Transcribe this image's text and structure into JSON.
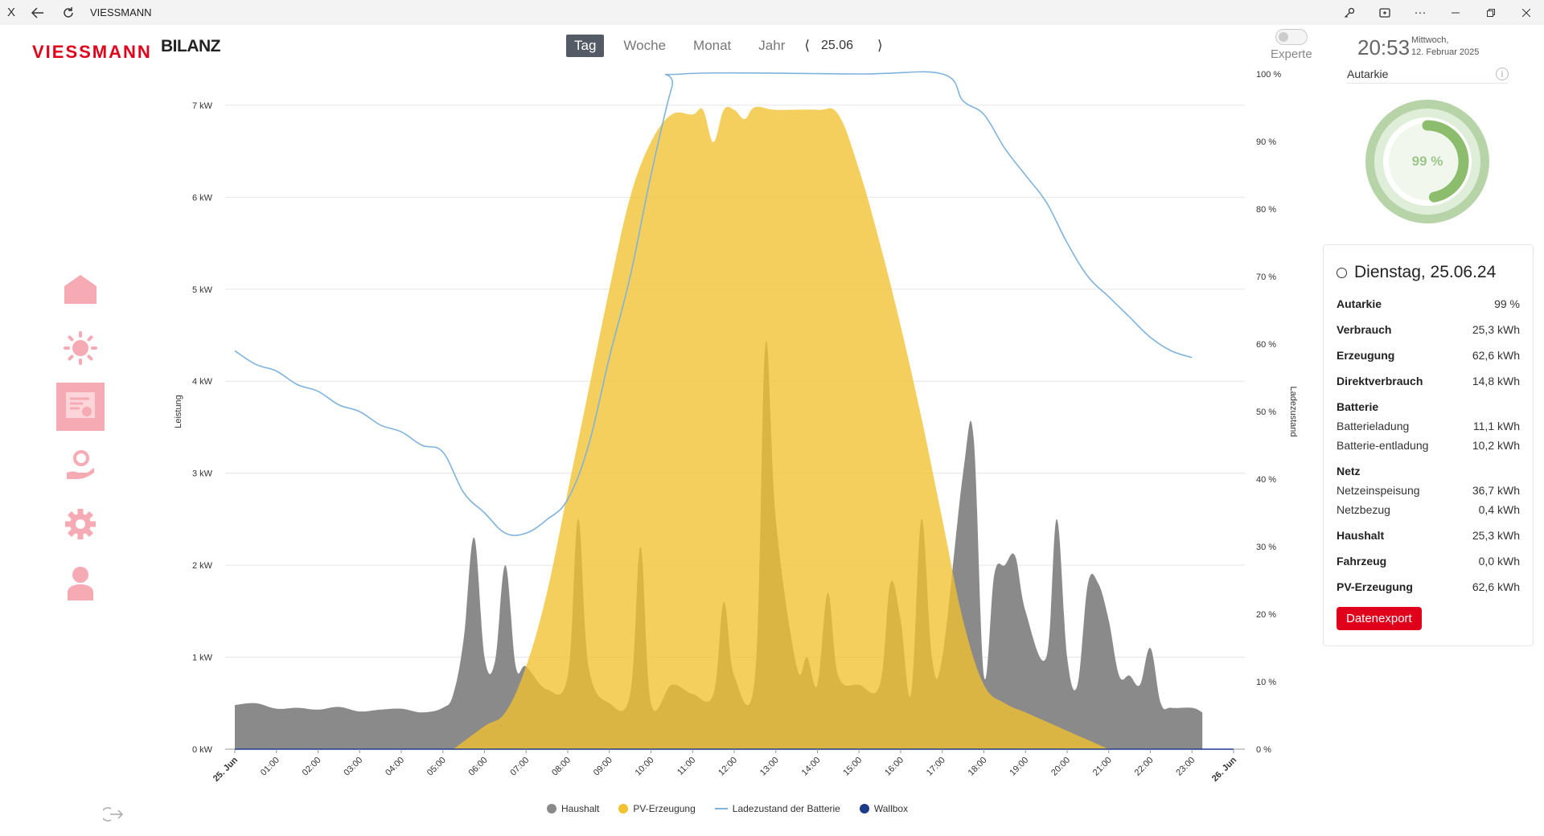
{
  "titlebar": {
    "app_name": "VIESSMANN"
  },
  "header": {
    "logo": "VIESSMANN",
    "title": "BILANZ",
    "tabs": [
      "Tag",
      "Woche",
      "Monat",
      "Jahr"
    ],
    "active_tab": "Tag",
    "date": "25.06",
    "prev_arrow": "⟨",
    "next_arrow": "⟩",
    "expert_label": "Experte"
  },
  "clock": {
    "time": "20:53",
    "weekday": "Mittwoch,",
    "date": "12. Februar 2025"
  },
  "autarkie": {
    "label": "Autarkie",
    "value": "99 %",
    "fraction": 0.99
  },
  "sidebar": {
    "items": [
      {
        "name": "home",
        "icon": "house-icon"
      },
      {
        "name": "pv",
        "icon": "sun-icon"
      },
      {
        "name": "bilanz",
        "icon": "report-icon",
        "active": true
      },
      {
        "name": "energy",
        "icon": "hand-icon"
      },
      {
        "name": "settings",
        "icon": "gear-icon"
      },
      {
        "name": "profile",
        "icon": "user-icon"
      }
    ],
    "accent": "#f6aab4"
  },
  "chart_data": {
    "type": "area",
    "ylabel_left": "Leistung",
    "ylabel_right": "Ladezustand",
    "ylim_left": [
      0,
      7.34
    ],
    "ylim_right": [
      0,
      100
    ],
    "yticks_left": [
      "0 kW",
      "1 kW",
      "2 kW",
      "3 kW",
      "4 kW",
      "5 kW",
      "6 kW",
      "7 kW"
    ],
    "yticks_right": [
      "0 %",
      "10 %",
      "20 %",
      "30 %",
      "40 %",
      "50 %",
      "60 %",
      "70 %",
      "80 %",
      "90 %",
      "100 %"
    ],
    "xticks": [
      "25. Jun",
      "01:00",
      "02:00",
      "03:00",
      "04:00",
      "05:00",
      "06:00",
      "07:00",
      "08:00",
      "09:00",
      "10:00",
      "11:00",
      "12:00",
      "13:00",
      "14:00",
      "15:00",
      "16:00",
      "17:00",
      "18:00",
      "19:00",
      "20:00",
      "21:00",
      "22:00",
      "23:00",
      "26. Jun"
    ],
    "x_unit": "hours",
    "series": [
      {
        "name": "Haushalt",
        "color": "#8a8a8a",
        "unit": "kW",
        "points": [
          [
            0,
            0.48
          ],
          [
            0.5,
            0.5
          ],
          [
            1,
            0.44
          ],
          [
            1.5,
            0.45
          ],
          [
            2,
            0.43
          ],
          [
            2.5,
            0.46
          ],
          [
            3,
            0.41
          ],
          [
            3.5,
            0.43
          ],
          [
            4,
            0.44
          ],
          [
            4.5,
            0.4
          ],
          [
            5,
            0.45
          ],
          [
            5.25,
            0.6
          ],
          [
            5.5,
            1.2
          ],
          [
            5.75,
            2.3
          ],
          [
            6,
            1.0
          ],
          [
            6.25,
            0.95
          ],
          [
            6.5,
            2.0
          ],
          [
            6.75,
            0.9
          ],
          [
            7,
            0.9
          ],
          [
            7.5,
            0.65
          ],
          [
            8,
            0.8
          ],
          [
            8.25,
            2.5
          ],
          [
            8.5,
            0.9
          ],
          [
            9,
            0.5
          ],
          [
            9.5,
            0.6
          ],
          [
            9.75,
            2.2
          ],
          [
            10,
            0.5
          ],
          [
            10.5,
            0.7
          ],
          [
            11,
            0.6
          ],
          [
            11.5,
            0.6
          ],
          [
            11.75,
            1.6
          ],
          [
            12,
            0.8
          ],
          [
            12.5,
            0.8
          ],
          [
            12.75,
            4.4
          ],
          [
            13,
            2.5
          ],
          [
            13.5,
            0.9
          ],
          [
            13.75,
            1.0
          ],
          [
            14,
            0.7
          ],
          [
            14.25,
            1.7
          ],
          [
            14.5,
            0.8
          ],
          [
            15,
            0.7
          ],
          [
            15.5,
            0.7
          ],
          [
            15.75,
            1.8
          ],
          [
            16,
            1.4
          ],
          [
            16.25,
            0.6
          ],
          [
            16.5,
            2.5
          ],
          [
            16.75,
            1.0
          ],
          [
            17,
            1.0
          ],
          [
            17.5,
            3.0
          ],
          [
            17.75,
            3.4
          ],
          [
            18,
            0.8
          ],
          [
            18.25,
            1.9
          ],
          [
            18.5,
            2.0
          ],
          [
            18.75,
            2.1
          ],
          [
            19,
            1.5
          ],
          [
            19.5,
            1.0
          ],
          [
            19.75,
            2.5
          ],
          [
            20,
            1.0
          ],
          [
            20.25,
            0.7
          ],
          [
            20.5,
            1.8
          ],
          [
            20.75,
            1.8
          ],
          [
            21,
            1.4
          ],
          [
            21.25,
            0.8
          ],
          [
            21.5,
            0.8
          ],
          [
            21.75,
            0.7
          ],
          [
            22,
            1.1
          ],
          [
            22.25,
            0.5
          ],
          [
            22.5,
            0.45
          ],
          [
            23,
            0.45
          ],
          [
            23.25,
            0.4
          ]
        ]
      },
      {
        "name": "PV-Erzeugung",
        "color": "#f2c230",
        "unit": "kW",
        "points": [
          [
            5.25,
            0
          ],
          [
            6,
            0.25
          ],
          [
            6.5,
            0.4
          ],
          [
            7,
            0.9
          ],
          [
            7.5,
            1.7
          ],
          [
            8,
            2.8
          ],
          [
            8.5,
            3.9
          ],
          [
            9,
            5.0
          ],
          [
            9.5,
            6.0
          ],
          [
            10,
            6.6
          ],
          [
            10.5,
            6.9
          ],
          [
            11,
            6.9
          ],
          [
            11.25,
            6.95
          ],
          [
            11.5,
            6.6
          ],
          [
            11.75,
            6.95
          ],
          [
            12,
            6.95
          ],
          [
            12.25,
            6.85
          ],
          [
            12.5,
            6.98
          ],
          [
            13,
            6.95
          ],
          [
            14,
            6.95
          ],
          [
            14.5,
            6.9
          ],
          [
            15,
            6.3
          ],
          [
            15.5,
            5.5
          ],
          [
            16,
            4.6
          ],
          [
            16.5,
            3.6
          ],
          [
            17,
            2.5
          ],
          [
            17.5,
            1.4
          ],
          [
            18,
            0.7
          ],
          [
            18.5,
            0.5
          ],
          [
            19,
            0.4
          ],
          [
            19.5,
            0.3
          ],
          [
            20,
            0.2
          ],
          [
            20.5,
            0.1
          ],
          [
            21,
            0.0
          ]
        ]
      },
      {
        "name": "Ladezustand der Batterie",
        "color": "#7fb3dc",
        "unit": "%",
        "points": [
          [
            0,
            59
          ],
          [
            0.5,
            57
          ],
          [
            1,
            56
          ],
          [
            1.5,
            54
          ],
          [
            2,
            53
          ],
          [
            2.5,
            51
          ],
          [
            3,
            50
          ],
          [
            3.5,
            48
          ],
          [
            4,
            47
          ],
          [
            4.5,
            45
          ],
          [
            5,
            44
          ],
          [
            5.5,
            38
          ],
          [
            6,
            35
          ],
          [
            6.5,
            32
          ],
          [
            7,
            32
          ],
          [
            7.5,
            34
          ],
          [
            8,
            37
          ],
          [
            8.5,
            45
          ],
          [
            9,
            58
          ],
          [
            9.5,
            70
          ],
          [
            10,
            85
          ],
          [
            10.5,
            98
          ],
          [
            10.75,
            100
          ],
          [
            15,
            100
          ],
          [
            17,
            100
          ],
          [
            17.5,
            96
          ],
          [
            18,
            94
          ],
          [
            18.5,
            89
          ],
          [
            19,
            85
          ],
          [
            19.5,
            81
          ],
          [
            20,
            75
          ],
          [
            20.5,
            70
          ],
          [
            21,
            67
          ],
          [
            21.5,
            64
          ],
          [
            22,
            61
          ],
          [
            22.5,
            59
          ],
          [
            23,
            58
          ]
        ]
      },
      {
        "name": "Wallbox",
        "color": "#1e3a8a",
        "unit": "kW",
        "points": [
          [
            0,
            0
          ],
          [
            24,
            0
          ]
        ]
      }
    ]
  },
  "legend": [
    {
      "label": "Haushalt",
      "color": "#8a8a8a",
      "kind": "dot"
    },
    {
      "label": "PV-Erzeugung",
      "color": "#f2c230",
      "kind": "dot"
    },
    {
      "label": "Ladezustand der Batterie",
      "color": "#7fb3dc",
      "kind": "line"
    },
    {
      "label": "Wallbox",
      "color": "#1e3a8a",
      "kind": "dot"
    }
  ],
  "summary": {
    "heading": "Dienstag, 25.06.24",
    "rows": [
      {
        "label": "Autarkie",
        "value": "99 %",
        "bold": true
      },
      {
        "label": "Verbrauch",
        "value": "25,3 kWh",
        "bold": true
      },
      {
        "label": "Erzeugung",
        "value": "62,6 kWh",
        "bold": true
      },
      {
        "label": "Direktverbrauch",
        "value": "14,8 kWh",
        "bold": true
      },
      {
        "label": "Batterie",
        "value": "",
        "bold": true
      },
      {
        "label": "Batterieladung",
        "value": "11,1 kWh",
        "bold": false
      },
      {
        "label": "Batterie-entladung",
        "value": "10,2 kWh",
        "bold": false
      },
      {
        "label": "Netz",
        "value": "",
        "bold": true
      },
      {
        "label": "Netzeinspeisung",
        "value": "36,7 kWh",
        "bold": false
      },
      {
        "label": "Netzbezug",
        "value": "0,4 kWh",
        "bold": false
      },
      {
        "label": "Haushalt",
        "value": "25,3 kWh",
        "bold": true
      },
      {
        "label": "Fahrzeug",
        "value": "0,0 kWh",
        "bold": true
      },
      {
        "label": "PV-Erzeugung",
        "value": "62,6 kWh",
        "bold": true
      }
    ],
    "export_button": "Datenexport"
  }
}
